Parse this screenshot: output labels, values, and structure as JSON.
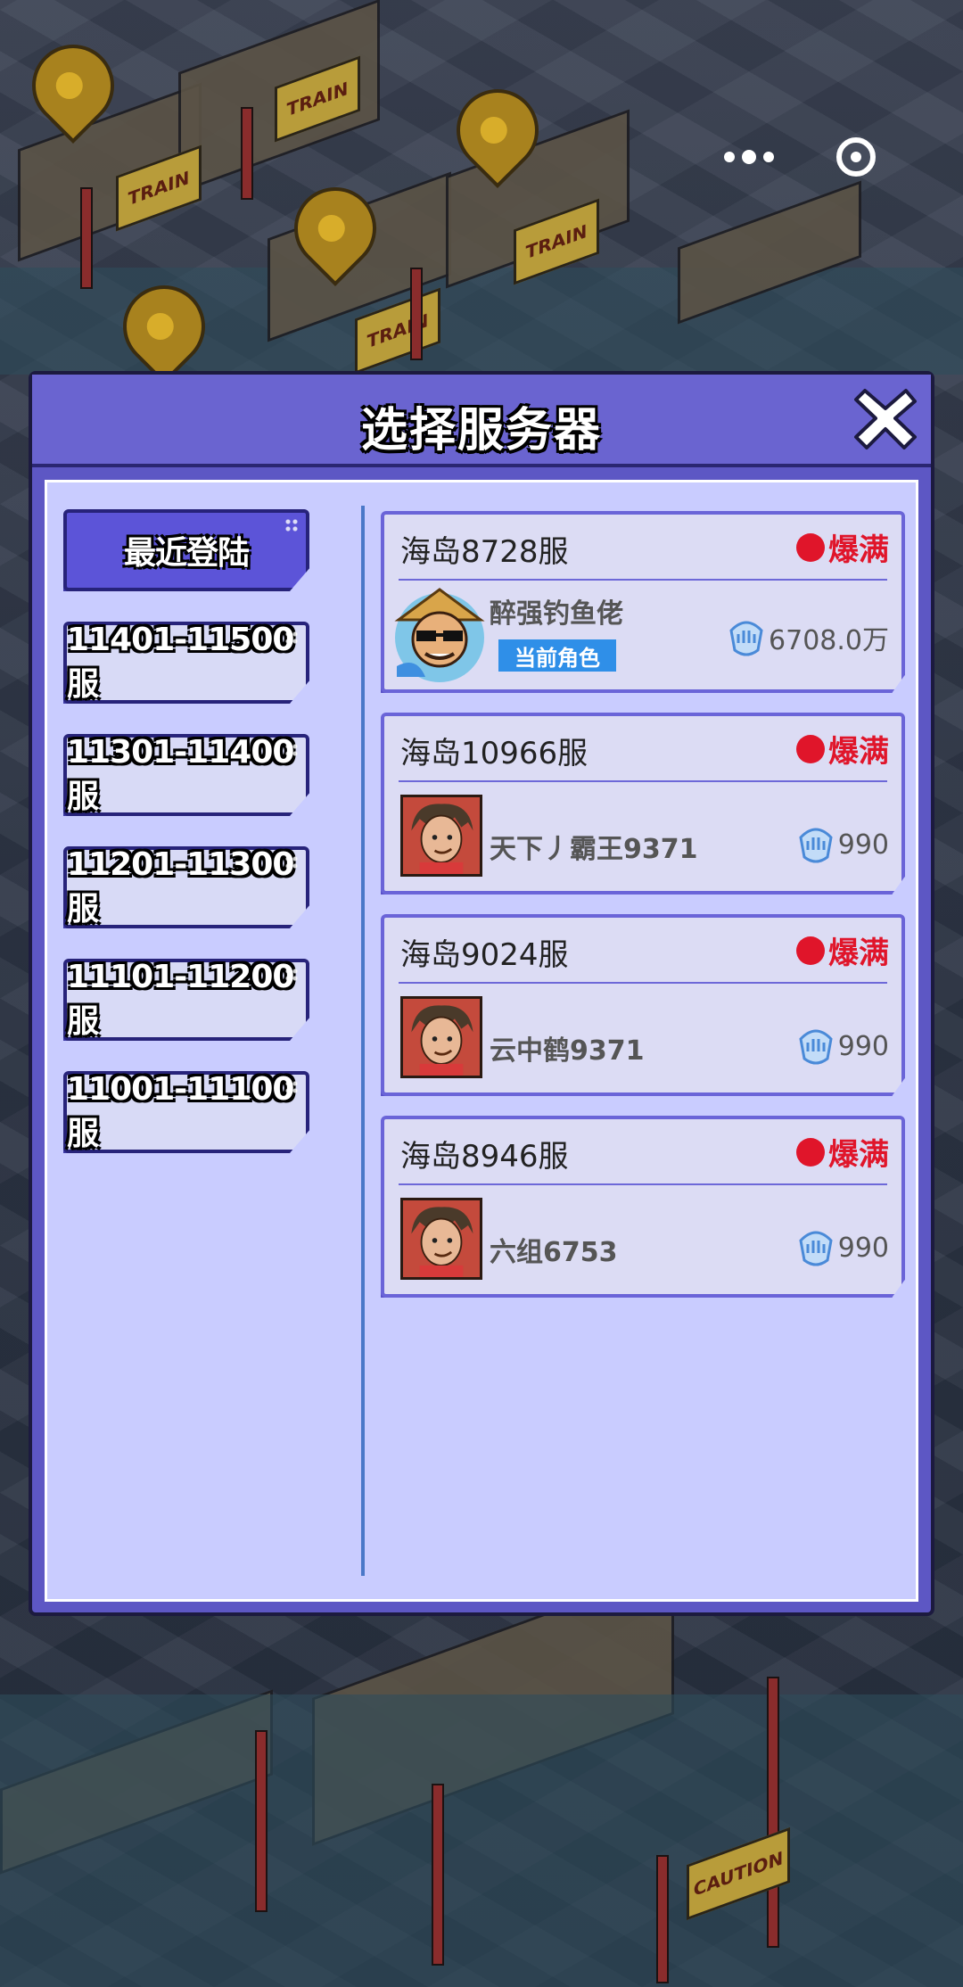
{
  "dialog": {
    "title": "选择服务器"
  },
  "tabs": [
    {
      "label": "最近登陆",
      "active": true
    },
    {
      "label": "11401-11500服",
      "active": false
    },
    {
      "label": "11301-11400服",
      "active": false
    },
    {
      "label": "11201-11300服",
      "active": false
    },
    {
      "label": "11101-11200服",
      "active": false
    },
    {
      "label": "11001-11100服",
      "active": false
    }
  ],
  "servers": [
    {
      "name": "海岛8728服",
      "status": "爆满",
      "character": "醉强钓鱼佬",
      "current_badge": "当前角色",
      "power": "6708.0万"
    },
    {
      "name": "海岛10966服",
      "status": "爆满",
      "character": "天下丿霸王9371",
      "power": "990"
    },
    {
      "name": "海岛9024服",
      "status": "爆满",
      "character": "云中鹤9371",
      "power": "990"
    },
    {
      "name": "海岛8946服",
      "status": "爆满",
      "character": "六组6753",
      "power": "990"
    }
  ],
  "background_signs": [
    "TRAIN",
    "TRAIN",
    "TRAIN",
    "TRAIN",
    "CAUTION"
  ],
  "colors": {
    "header": "#6a64d0",
    "panel": "#c9ccff",
    "active_tab": "#5c54d8",
    "status_full": "#e0152a",
    "current_badge": "#2f8fe8"
  }
}
